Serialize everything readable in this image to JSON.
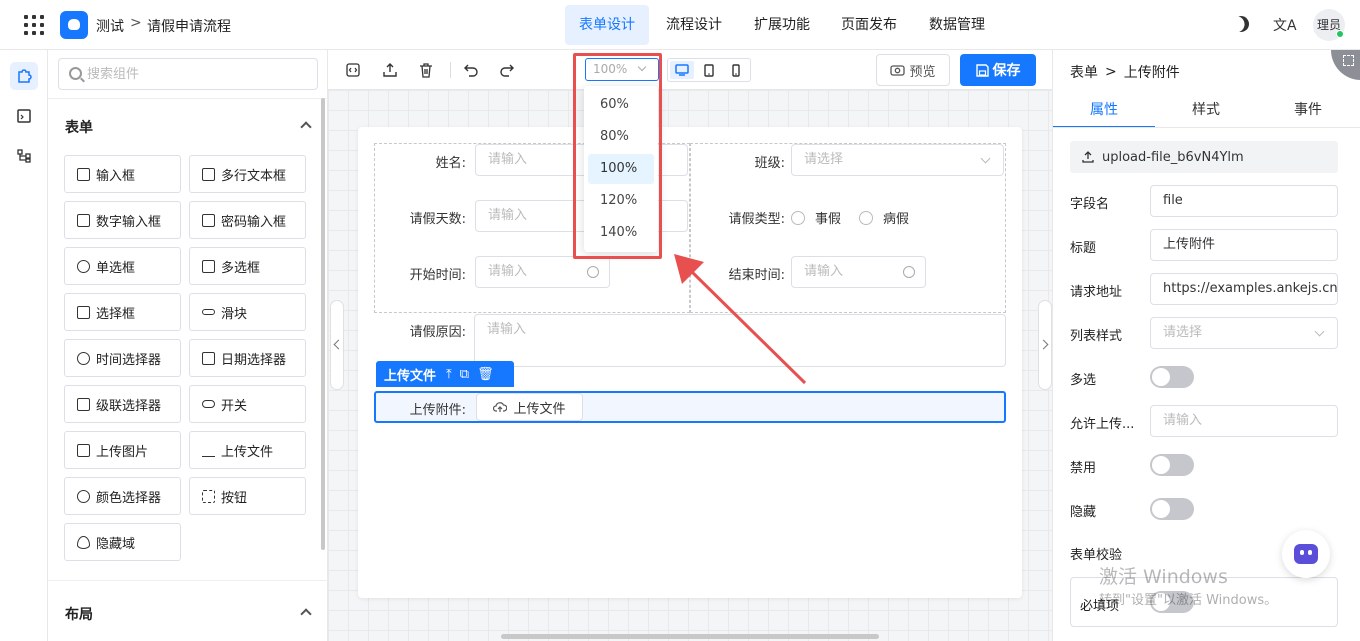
{
  "header": {
    "app_title": "测试",
    "breadcrumb_sep": ">",
    "page_name": "请假申请流程",
    "nav_tabs": [
      "表单设计",
      "流程设计",
      "扩展功能",
      "页面发布",
      "数据管理"
    ],
    "active_tab": "表单设计",
    "translate_glyph": "文A",
    "user_name": "理员"
  },
  "component_panel": {
    "search_placeholder": "搜索组件",
    "section_form": "表单",
    "components": [
      "输入框",
      "多行文本框",
      "数字输入框",
      "密码输入框",
      "单选框",
      "多选框",
      "选择框",
      "滑块",
      "时间选择器",
      "日期选择器",
      "级联选择器",
      "开关",
      "上传图片",
      "上传文件",
      "颜色选择器",
      "按钮",
      "隐藏域"
    ],
    "section_layout": "布局"
  },
  "toolbar": {
    "zoom_value": "100%",
    "preview_label": "预览",
    "save_label": "保存"
  },
  "zoom_options": [
    "60%",
    "80%",
    "100%",
    "120%",
    "140%"
  ],
  "zoom_selected": "100%",
  "form": {
    "name_label": "姓名:",
    "name_placeholder": "请输入",
    "class_label": "班级:",
    "class_placeholder": "请选择",
    "days_label": "请假天数:",
    "days_placeholder": "请输入",
    "type_label": "请假类型:",
    "type_options": [
      "事假",
      "病假"
    ],
    "start_label": "开始时间:",
    "start_placeholder": "请输入",
    "end_label": "结束时间:",
    "end_placeholder": "请输入",
    "reason_label": "请假原因:",
    "reason_placeholder": "请输入",
    "upload_tag": "上传文件",
    "upload_label": "上传附件:",
    "upload_button": "上传文件"
  },
  "properties": {
    "crumb_form": "表单",
    "crumb_sep": ">",
    "crumb_item": "上传附件",
    "tabs": [
      "属性",
      "样式",
      "事件"
    ],
    "active_tab": "属性",
    "field_id": "upload-file_b6vN4Ylm",
    "field_name_label": "字段名",
    "field_name_value": "file",
    "title_label": "标题",
    "title_value": "上传附件",
    "url_label": "请求地址",
    "url_value": "https://examples.ankejs.cn,",
    "list_style_label": "列表样式",
    "list_style_placeholder": "请选择",
    "multiple_label": "多选",
    "allow_label": "允许上传...",
    "allow_placeholder": "请输入",
    "disabled_label": "禁用",
    "hidden_label": "隐藏",
    "validation_label": "表单校验",
    "required_label": "必填项"
  },
  "watermark": {
    "line1": "激活 Windows",
    "line2": "转到\"设置\"以激活 Windows。"
  },
  "colors": {
    "primary": "#1677ff",
    "highlight_box": "#e85050",
    "arrow": "#e85050"
  }
}
